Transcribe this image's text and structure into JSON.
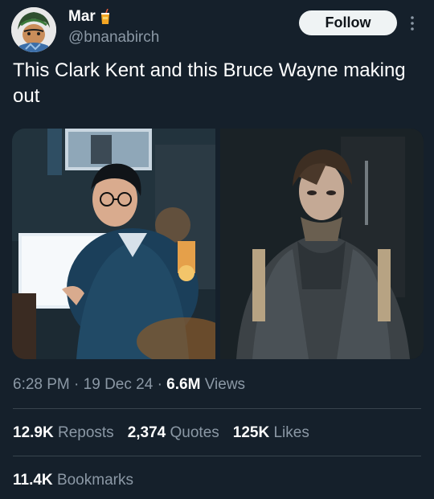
{
  "author": {
    "display_name": "Mar",
    "handle": "@bnanabirch",
    "emoji_icon": "drink-emoji-icon"
  },
  "header": {
    "follow_label": "Follow",
    "more_icon": "more-vertical-icon"
  },
  "tweet": {
    "text": "This Clark Kent and this Bruce Wayne making out"
  },
  "media": {
    "images": [
      {
        "name": "clark-kent-photo"
      },
      {
        "name": "bruce-wayne-photo"
      }
    ]
  },
  "meta": {
    "time": "6:28 PM",
    "date": "19 Dec 24",
    "separator": "·",
    "views_count": "6.6M",
    "views_label": "Views"
  },
  "stats": {
    "reposts_count": "12.9K",
    "reposts_label": "Reposts",
    "quotes_count": "2,374",
    "quotes_label": "Quotes",
    "likes_count": "125K",
    "likes_label": "Likes",
    "bookmarks_count": "11.4K",
    "bookmarks_label": "Bookmarks"
  },
  "colors": {
    "background": "#15202b",
    "secondary_text": "#8b98a5",
    "follow_button_bg": "#eff3f4",
    "divider": "#38444d"
  }
}
